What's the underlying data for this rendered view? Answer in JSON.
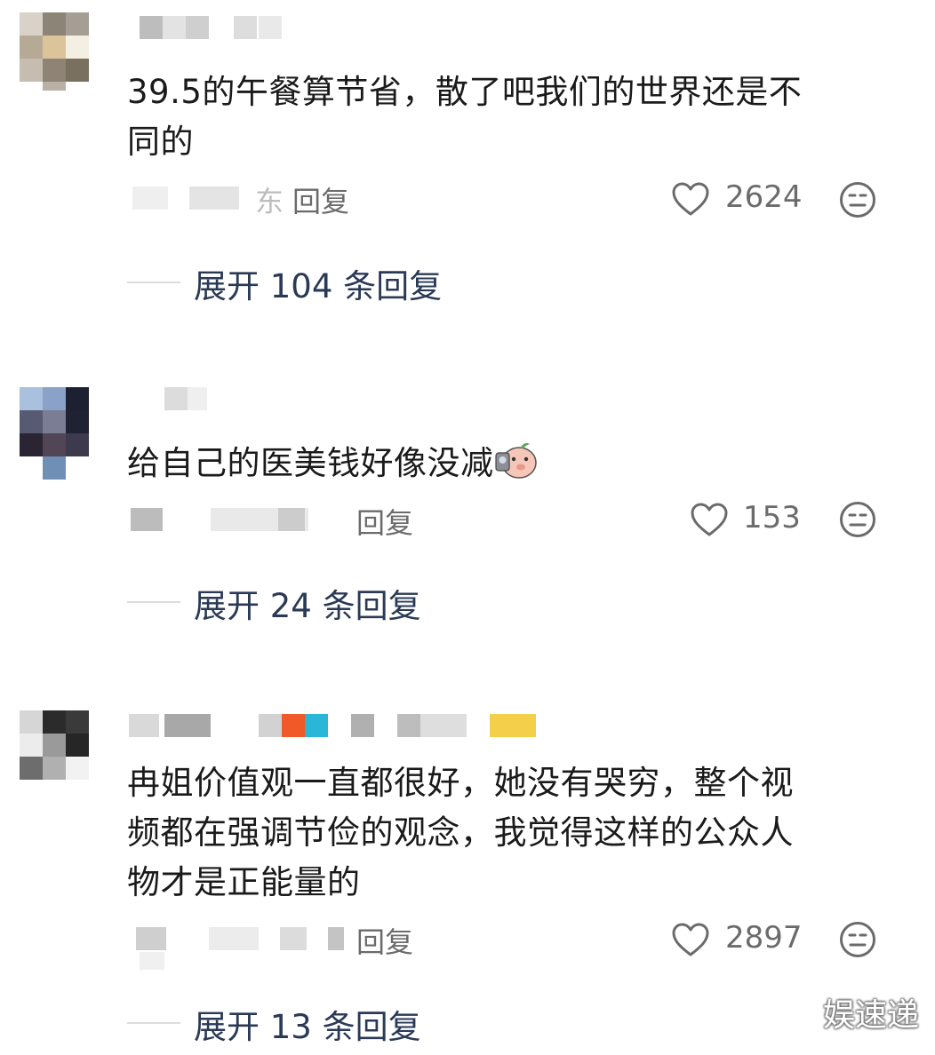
{
  "comments": [
    {
      "text_lines": [
        "39.5的午餐算节省，散了吧我们的世界还是不",
        "同的"
      ],
      "reply_label": "回复",
      "meta_fragment": "东",
      "like_count": "2624",
      "expand_label": "展开 104 条回复"
    },
    {
      "text": "给自己的医美钱好像没减",
      "reply_label": "回复",
      "like_count": "153",
      "expand_label": "展开 24 条回复"
    },
    {
      "text_lines": [
        "冉姐价值观一直都很好，她没有哭穷，整个视",
        "频都在强调节俭的观念，我觉得这样的公众人",
        "物才是正能量的"
      ],
      "reply_label": "回复",
      "like_count": "2897",
      "expand_label": "展开 13 条回复"
    }
  ],
  "watermark": "娱速递",
  "icons": {
    "like": "heart-outline-icon",
    "dislike": "neutral-face-icon",
    "sticker": "pig-face-sticker-icon"
  },
  "colors": {
    "text": "#1a1a1a",
    "meta": "#6b6b6b",
    "expand": "#2a3a56"
  }
}
